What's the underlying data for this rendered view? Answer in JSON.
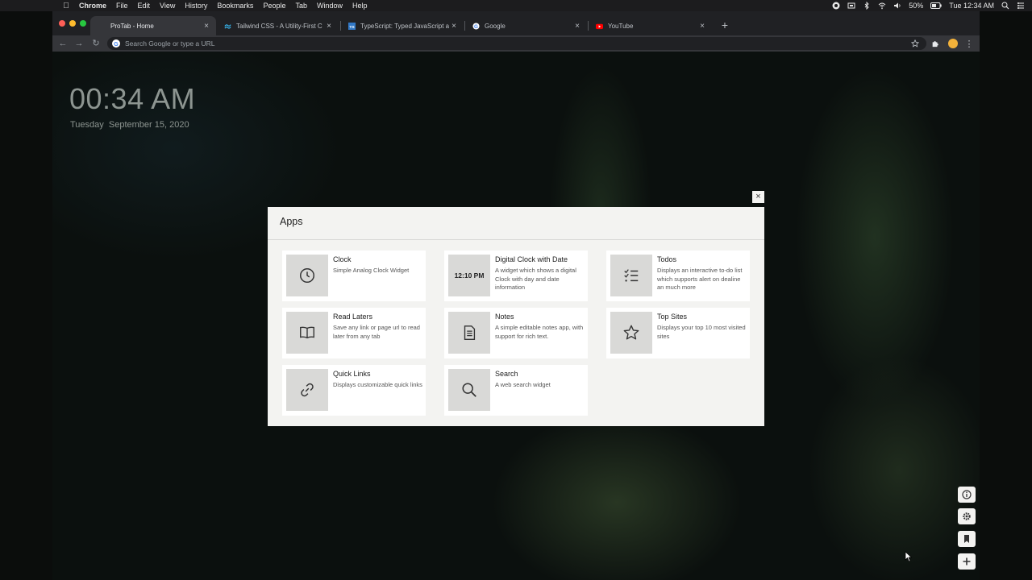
{
  "menubar": {
    "app_name": "Chrome",
    "menus": [
      "File",
      "Edit",
      "View",
      "History",
      "Bookmarks",
      "People",
      "Tab",
      "Window",
      "Help"
    ],
    "battery": "50%",
    "datetime": "Tue 12:34 AM"
  },
  "tabs": [
    {
      "title": "ProTab - Home",
      "active": true,
      "icon": "protab-icon"
    },
    {
      "title": "Tailwind CSS - A Utility-First C",
      "active": false,
      "icon": "tailwind-icon"
    },
    {
      "title": "TypeScript: Typed JavaScript a",
      "active": false,
      "icon": "typescript-icon"
    },
    {
      "title": "Google",
      "active": false,
      "icon": "google-icon"
    },
    {
      "title": "YouTube",
      "active": false,
      "icon": "youtube-icon"
    }
  ],
  "omnibox": {
    "placeholder": "Search Google or type a URL",
    "value": ""
  },
  "clock": {
    "time": "00:34 AM",
    "date": "Tuesday  September 15, 2020"
  },
  "modal": {
    "title": "Apps",
    "close_label": "×",
    "apps": [
      {
        "name": "Clock",
        "desc": "Simple Analog Clock Widget",
        "icon": "clock-icon"
      },
      {
        "name": "Digital Clock with Date",
        "desc": "A widget which shows a digital Clock with day and date information",
        "thumb_text": "12:10 PM"
      },
      {
        "name": "Todos",
        "desc": "Displays an interactive to-do list which supports alert on dealine an much more",
        "icon": "checklist-icon"
      },
      {
        "name": "Read Laters",
        "desc": "Save any link or page url to read later from any tab",
        "icon": "book-icon"
      },
      {
        "name": "Notes",
        "desc": "A simple editable notes app, with support for rich text.",
        "icon": "notes-icon"
      },
      {
        "name": "Top Sites",
        "desc": "Displays your top 10 most visited sites",
        "icon": "star-icon"
      },
      {
        "name": "Quick Links",
        "desc": "Displays customizable quick links",
        "icon": "link-icon"
      },
      {
        "name": "Search",
        "desc": "A web search widget",
        "icon": "search-icon"
      }
    ]
  },
  "side_buttons": [
    "info-icon",
    "settings-icon",
    "bookmark-icon",
    "plus-icon"
  ],
  "colors": {
    "modal_bg": "#f3f3f1",
    "card_bg": "#ffffff",
    "thumb_bg": "#d9d9d7",
    "chrome_dark": "#202124"
  }
}
